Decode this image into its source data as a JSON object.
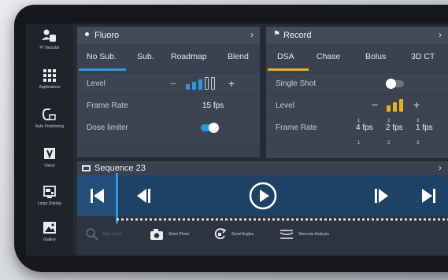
{
  "sidebar": {
    "items": [
      {
        "label": "Pt Vascular",
        "icon": "user-hand-icon"
      },
      {
        "label": "Applications",
        "icon": "grid-icon"
      },
      {
        "label": "Auto Positioning",
        "icon": "c-arm-icon"
      },
      {
        "label": "Vision",
        "icon": "vision-v-icon"
      },
      {
        "label": "Large Display",
        "icon": "display-icon"
      },
      {
        "label": "Gallery",
        "icon": "gallery-image-icon"
      }
    ]
  },
  "fluoro": {
    "title": "Fluoro",
    "tabs": [
      "No Sub.",
      "Sub.",
      "Roadmap",
      "Blend"
    ],
    "active_tab": 0,
    "accent": "#2a9bd8",
    "level_label": "Level",
    "level_value": 3,
    "level_max": 5,
    "frame_rate_label": "Frame Rate",
    "frame_rate_value": "15 fps",
    "dose_limiter_label": "Dose limiter",
    "dose_limiter_on": true
  },
  "record": {
    "title": "Record",
    "tabs": [
      "DSA",
      "Chase",
      "Bolus",
      "3D CT"
    ],
    "active_tab": 0,
    "accent": "#e6b01e",
    "single_shot_label": "Single Shot",
    "single_shot_on": false,
    "level_label": "Level",
    "level_value": 3,
    "level_max": 3,
    "frame_rate_label": "Frame Rate",
    "frame_rates": [
      {
        "index": "1",
        "value": "4 fps"
      },
      {
        "index": "2",
        "value": "2 fps"
      },
      {
        "index": "3",
        "value": "1 fps"
      }
    ],
    "next_row_indices": [
      "1",
      "2",
      "3"
    ]
  },
  "sequence": {
    "title": "Sequence 23",
    "tools": [
      {
        "label": "Start Zoom",
        "icon": "zoom-hand-icon",
        "enabled": false
      },
      {
        "label": "Store Photo",
        "icon": "camera-icon",
        "enabled": true
      },
      {
        "label": "Send Angles",
        "icon": "rotate-angles-icon",
        "enabled": true
      },
      {
        "label": "Stenosis Analysis",
        "icon": "stenosis-icon",
        "enabled": true
      }
    ]
  },
  "colors": {
    "playhead": "#2a9bd8",
    "strip": "#1d4266"
  }
}
